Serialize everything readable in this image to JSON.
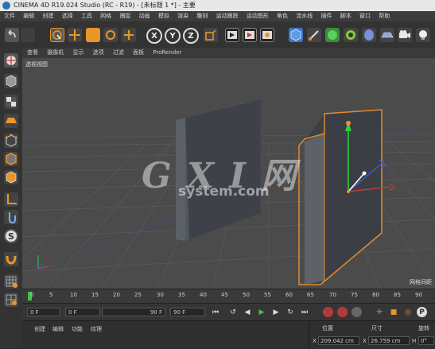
{
  "window": {
    "title": "CINEMA 4D R19.024 Studio (RC - R19) - [未标题 1 *] - 主要"
  },
  "menubar": {
    "items": [
      "文件",
      "编辑",
      "创建",
      "选择",
      "工具",
      "网格",
      "捕捉",
      "动画",
      "模拟",
      "渲染",
      "雕刻",
      "运动跟踪",
      "运动图形",
      "角色",
      "流水线",
      "插件",
      "脚本",
      "窗口",
      "帮助"
    ]
  },
  "toolbar": {
    "icons": [
      "undo-icon",
      "live-selection-icon",
      "move-icon",
      "scale-icon",
      "rotate-icon",
      "add-icon",
      "x-axis-icon",
      "y-axis-icon",
      "z-axis-icon",
      "world-coord-icon",
      "render-view-icon",
      "render-picture-viewer-icon",
      "render-settings-icon",
      "cube-icon",
      "pen-icon",
      "subdivision-icon",
      "cloner-icon",
      "deformer-icon",
      "floor-icon",
      "camera-icon",
      "light-icon"
    ],
    "axis_x": "X",
    "axis_y": "Y",
    "axis_z": "Z"
  },
  "viewport_menu": {
    "items": [
      "查看",
      "摄像机",
      "显示",
      "选项",
      "过滤",
      "面板",
      "ProRender"
    ]
  },
  "viewport": {
    "label": "透视视图",
    "grid_label": "网格间距"
  },
  "watermark": {
    "main": "G X I 网",
    "sub": "system.com"
  },
  "timeline": {
    "ticks": [
      "0",
      "5",
      "10",
      "15",
      "20",
      "25",
      "30",
      "35",
      "40",
      "45",
      "50",
      "55",
      "60",
      "65",
      "70",
      "75",
      "80",
      "85",
      "90"
    ]
  },
  "transport": {
    "start_frame": "0 F",
    "current_frame": "0 F",
    "end_frame": "90 F",
    "end_frame_2": "90 F"
  },
  "attributes_panel": {
    "tabs": [
      "创建",
      "编辑",
      "功能",
      "纹理"
    ]
  },
  "coordinates_panel": {
    "headers": [
      "位置",
      "尺寸",
      "旋转"
    ],
    "x_label": "X",
    "x_value": "209.042 cm",
    "x2_label": "X",
    "x2_value": "26.759 cm",
    "h_label": "H",
    "h_value": "0°"
  },
  "colors": {
    "viewport_bg": "#4b4b4b",
    "selection_orange": "#e28a2c",
    "axis_green": "#2bd13a",
    "axis_red": "#d23b3b",
    "axis_blue": "#3a5ed6",
    "icon_orange": "#e8952a",
    "timeline_green": "#43c24a"
  }
}
